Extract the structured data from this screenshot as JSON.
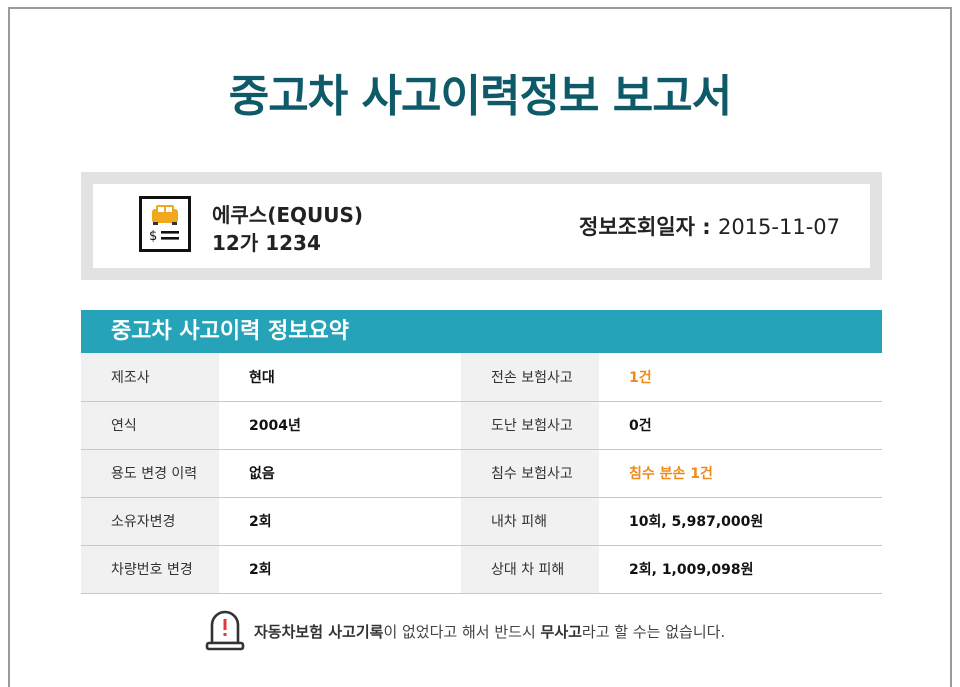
{
  "title": "중고차 사고이력정보 보고서",
  "vehicle": {
    "icon": "car-price-icon",
    "name": "에쿠스(EQUUS)",
    "plate": "12가 1234",
    "date_label": "정보조회일자 :",
    "date_value": "2015-11-07"
  },
  "summary": {
    "header": "중고차 사고이력 정보요약",
    "rows": [
      {
        "label1": "제조사",
        "value1": "현대",
        "label2": "전손 보험사고",
        "value2": "1건"
      },
      {
        "label1": "연식",
        "value1": "2004년",
        "label2": "도난 보험사고",
        "value2": "0건"
      },
      {
        "label1": "용도 변경 이력",
        "value1": "없음",
        "label2": "침수 보험사고",
        "value2": "침수 분손 1건"
      },
      {
        "label1": "소유자변경",
        "value1": "2회",
        "label2": "내차 피해",
        "value2": "10회, 5,987,000원"
      },
      {
        "label1": "차량번호 변경",
        "value1": "2회",
        "label2": "상대 차 피해",
        "value2": "2회, 1,009,098원"
      }
    ]
  },
  "notice": {
    "icon": "warning-siren-icon",
    "part1": "자동차보험 사고기록",
    "part2": "이 없었다고 해서 반드시 ",
    "part3": "무사고",
    "part4": "라고 할 수는 없습니다."
  },
  "colors": {
    "title": "#0f5a68",
    "header_bg": "#26a3b8",
    "highlight": "#ef8a1a"
  }
}
